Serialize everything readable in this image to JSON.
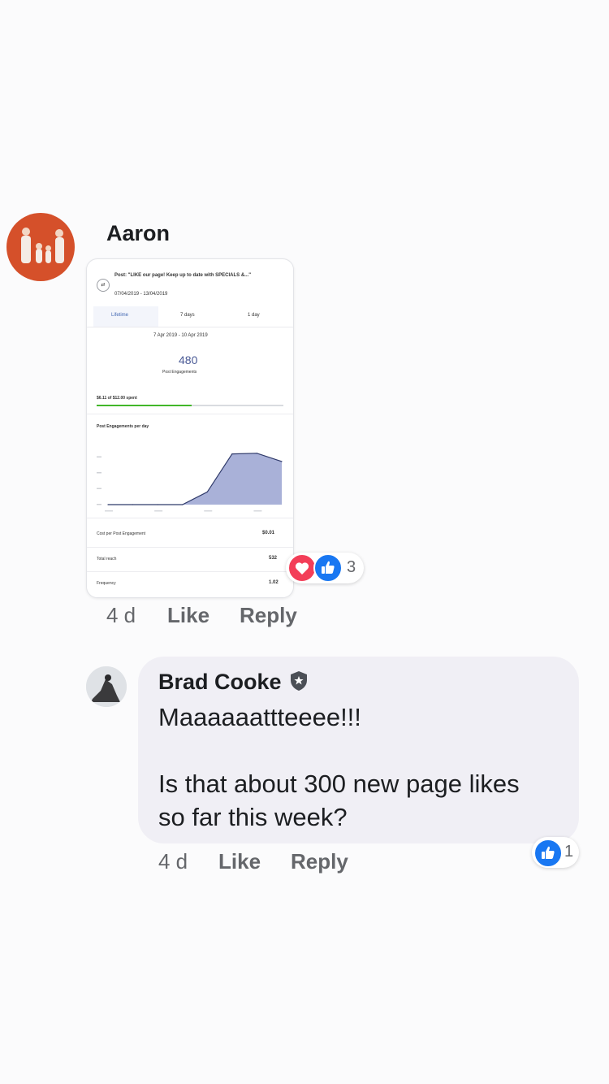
{
  "comments": [
    {
      "author": "Aaron",
      "time": "4 d",
      "like_label": "Like",
      "reply_label": "Reply",
      "reaction_count": "3",
      "reactions": [
        "love",
        "like"
      ],
      "attachment": {
        "post_title": "Post: \"LIKE our page! Keep up to date with SPECIALS &...\"",
        "post_dates": "07/04/2019 - 13/04/2019",
        "tabs": [
          "Lifetime",
          "7 days",
          "1 day"
        ],
        "selected_tab": "Lifetime",
        "date_range": "7 Apr 2019 - 10 Apr 2019",
        "engagements": "480",
        "engagements_label": "Post Engagements",
        "budget_label": "$6.11 of $12.00 spent",
        "budget_fraction": 0.51,
        "chart_label": "Post Engagements per day",
        "stats": [
          {
            "label": "Cost per Post Engagement",
            "value": "$0.01"
          },
          {
            "label": "Total reach",
            "value": "532"
          },
          {
            "label": "Frequency",
            "value": "1.02"
          }
        ]
      }
    },
    {
      "author": "Brad Cooke",
      "verified_badge": "shield-badge-icon",
      "text": "Maaaaaattteeee!!!\n\nIs that about 300 new page likes\nso far this week?",
      "time": "4 d",
      "like_label": "Like",
      "reply_label": "Reply",
      "reaction_count": "1",
      "reactions": [
        "like"
      ]
    }
  ],
  "chart_data": {
    "type": "area",
    "title": "Post Engagements per day",
    "x": [
      "",
      "",
      "",
      "",
      "",
      "",
      "",
      ""
    ],
    "series": [
      {
        "values": [
          0,
          0,
          0,
          0,
          20,
          80,
          81,
          68
        ]
      }
    ],
    "ylim": [
      0,
      100
    ],
    "color": "#a9b1d8",
    "grid": false
  },
  "colors": {
    "like_blue": "#1877f2",
    "love_red": "#f33e58",
    "bubble": "#f0eff5",
    "budget_green": "#42b72a",
    "area_fill": "#a9b1d8"
  }
}
